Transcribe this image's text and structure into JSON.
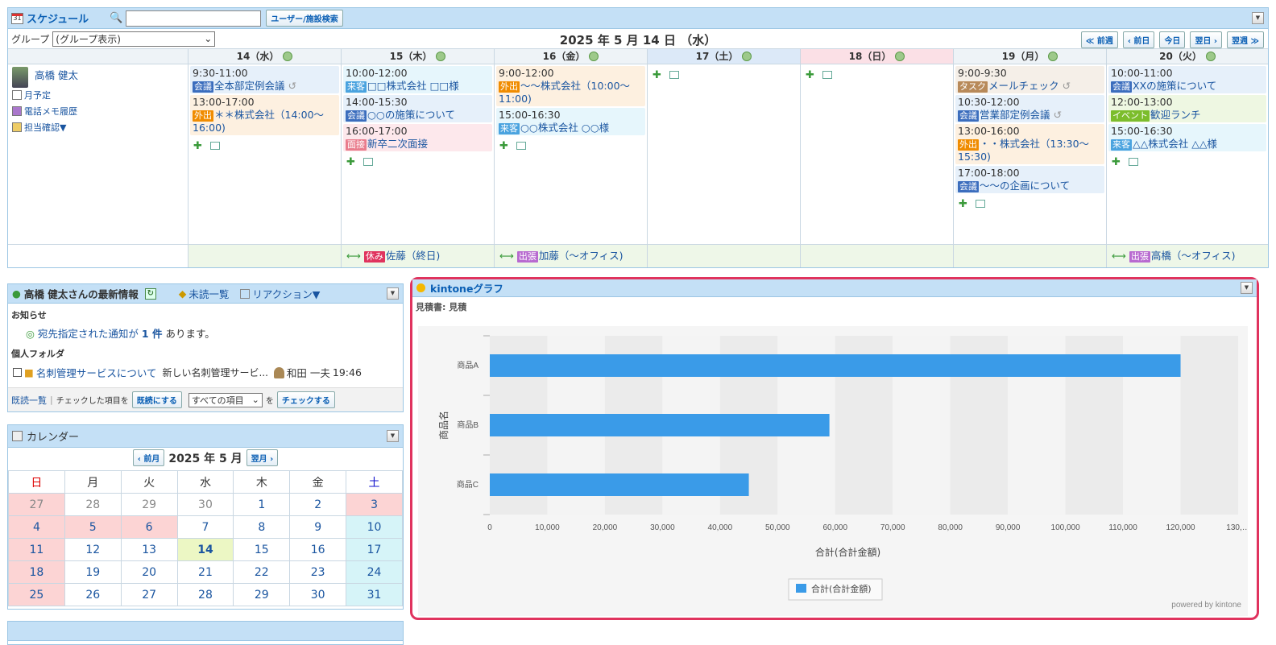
{
  "schedule": {
    "title": "スケジュール",
    "calendar_icon_text": "31",
    "search_placeholder": "",
    "search_button": "ユーザー/施設検索",
    "group_label": "グループ",
    "group_select": "(グループ表示)",
    "date_title": "2025 年 5 月 14 日 （水）",
    "nav": [
      "≪ 前週",
      "‹ 前日",
      "今日",
      "翌日 ›",
      "翌週 ≫"
    ],
    "user": {
      "name": "高橋 健太",
      "links": [
        "月予定",
        "電話メモ履歴",
        "担当確認▼"
      ]
    },
    "days": [
      {
        "label": "14（水）",
        "bg": "#eef3f7",
        "events": [
          {
            "time": "9:30-11:00",
            "tag": "会議",
            "tagColor": "#3b6dbd",
            "title": "全本部定例会議",
            "bg": "#e6f0fa",
            "repeat": true
          },
          {
            "time": "13:00-17:00",
            "tag": "外出",
            "tagColor": "#f08c00",
            "title": "＊＊株式会社（14:00〜16:00)",
            "bg": "#fdf0e0"
          }
        ]
      },
      {
        "label": "15（木）",
        "bg": "#eef3f7",
        "events": [
          {
            "time": "10:00-12:00",
            "tag": "来客",
            "tagColor": "#4aa3df",
            "title": "□□株式会社 □□様",
            "bg": "#e6f6fc"
          },
          {
            "time": "14:00-15:30",
            "tag": "会議",
            "tagColor": "#3b6dbd",
            "title": "○○の施策について",
            "bg": "#e6f0fa"
          },
          {
            "time": "16:00-17:00",
            "tag": "面接",
            "tagColor": "#e97c8c",
            "title": "新卒二次面接",
            "bg": "#fde8ec"
          }
        ]
      },
      {
        "label": "16（金）",
        "bg": "#eef3f7",
        "events": [
          {
            "time": "9:00-12:00",
            "tag": "外出",
            "tagColor": "#f08c00",
            "title": "〜〜株式会社（10:00〜11:00)",
            "bg": "#fdf0e0"
          },
          {
            "time": "15:00-16:30",
            "tag": "来客",
            "tagColor": "#4aa3df",
            "title": "○○株式会社 ○○様",
            "bg": "#e6f6fc"
          }
        ]
      },
      {
        "label": "17（土）",
        "bg": "#dce9f8",
        "events": []
      },
      {
        "label": "18（日）",
        "bg": "#fbe0e6",
        "events": []
      },
      {
        "label": "19（月）",
        "bg": "#eef3f7",
        "events": [
          {
            "time": "9:00-9:30",
            "tag": "タスク",
            "tagColor": "#b88a5a",
            "title": "メールチェック",
            "bg": "#f5efe8",
            "repeat": true
          },
          {
            "time": "10:30-12:00",
            "tag": "会議",
            "tagColor": "#3b6dbd",
            "title": "営業部定例会議",
            "bg": "#e6f0fa",
            "repeat": true
          },
          {
            "time": "13:00-16:00",
            "tag": "外出",
            "tagColor": "#f08c00",
            "title": "・・株式会社（13:30〜15:30)",
            "bg": "#fdf0e0"
          },
          {
            "time": "17:00-18:00",
            "tag": "会議",
            "tagColor": "#3b6dbd",
            "title": "〜〜の企画について",
            "bg": "#e6f0fa"
          }
        ]
      },
      {
        "label": "20（火）",
        "bg": "#eef3f7",
        "events": [
          {
            "time": "10:00-11:00",
            "tag": "会議",
            "tagColor": "#3b6dbd",
            "title": "XXの施策について",
            "bg": "#e6f0fa"
          },
          {
            "time": "12:00-13:00",
            "tag": "イベント",
            "tagColor": "#7cbd2c",
            "title": "歓迎ランチ",
            "bg": "#eef7e2"
          },
          {
            "time": "15:00-16:30",
            "tag": "来客",
            "tagColor": "#4aa3df",
            "title": "△△株式会社 △△様",
            "bg": "#e6f6fc"
          }
        ]
      }
    ],
    "banners": [
      {
        "col": 2,
        "span": 1,
        "tag": "休み",
        "tagColor": "#e0335e",
        "text": "佐藤（終日)"
      },
      {
        "col": 3,
        "span": 1,
        "tag": "出張",
        "tagColor": "#b86ad0",
        "text": "加藤（〜オフィス)"
      },
      {
        "col": 7,
        "span": 1,
        "tag": "出張",
        "tagColor": "#b86ad0",
        "text": "高橋（〜オフィス)"
      }
    ]
  },
  "info": {
    "title": "高橋 健太さんの最新情報",
    "unread": "未読一覧",
    "reaction": "リアクション▼",
    "notice_section": "お知らせ",
    "notice_pre": "宛先指定された通知が",
    "notice_count": "1 件",
    "notice_post": "あります。",
    "folder_section": "個人フォルダ",
    "item_title": "名刺管理サービスについて",
    "item_desc": "新しい名刺管理サービ...",
    "item_user": "和田 一夫",
    "item_time": "19:46",
    "read_list": "既読一覧",
    "checked_text": "チェックした項目を",
    "mark_read": "既読にする",
    "all_items": "すべての項目",
    "wo": "を",
    "check_btn": "チェックする"
  },
  "calendar": {
    "title": "カレンダー",
    "prev": "‹ 前月",
    "month": "2025 年 5 月",
    "next": "翌月 ›",
    "weekdays": [
      "日",
      "月",
      "火",
      "水",
      "木",
      "金",
      "土"
    ],
    "weeks": [
      [
        "27",
        "28",
        "29",
        "30",
        "1",
        "2",
        "3"
      ],
      [
        "4",
        "5",
        "6",
        "7",
        "8",
        "9",
        "10"
      ],
      [
        "11",
        "12",
        "13",
        "14",
        "15",
        "16",
        "17"
      ],
      [
        "18",
        "19",
        "20",
        "21",
        "22",
        "23",
        "24"
      ],
      [
        "25",
        "26",
        "27",
        "28",
        "29",
        "30",
        "31"
      ]
    ],
    "today": "14",
    "holidays": [
      "3",
      "4",
      "5",
      "6"
    ]
  },
  "kintone": {
    "title": "kintoneグラフ",
    "subtitle": "見積書: 見積",
    "powered": "powered by kintone"
  },
  "chart_data": {
    "type": "bar",
    "orientation": "horizontal",
    "categories": [
      "商品A",
      "商品B",
      "商品C"
    ],
    "series": [
      {
        "name": "合計(合計金額)",
        "values": [
          120000,
          59000,
          45000
        ],
        "color": "#3a9be8"
      }
    ],
    "xlabel": "合計(合計金額)",
    "ylabel": "商品名",
    "xlim": [
      0,
      130000
    ],
    "xticks": [
      "0",
      "10,000",
      "20,000",
      "30,000",
      "40,000",
      "50,000",
      "60,000",
      "70,000",
      "80,000",
      "90,000",
      "100,000",
      "110,000",
      "120,000",
      "130,…"
    ],
    "legend": "bottom-center",
    "grid": true
  }
}
